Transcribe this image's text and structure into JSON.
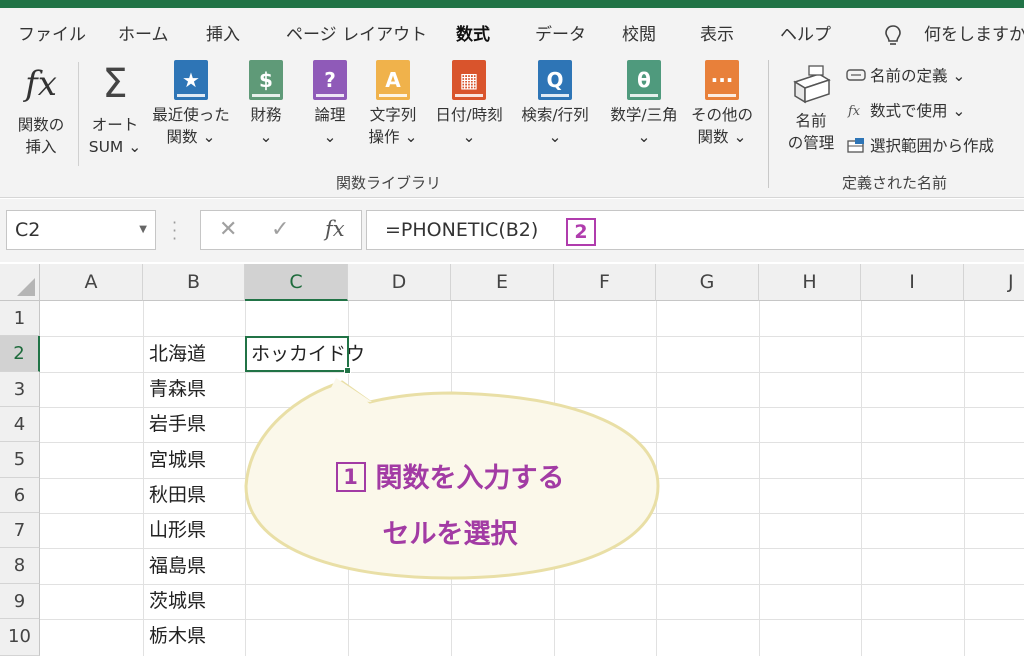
{
  "tabs": [
    "ファイル",
    "ホーム",
    "挿入",
    "ページ レイアウト",
    "数式",
    "データ",
    "校閲",
    "表示",
    "ヘルプ"
  ],
  "active_tab": "数式",
  "tell_me": "何をしますか",
  "ribbon": {
    "insert_function": {
      "line1": "関数の",
      "line2": "挿入"
    },
    "autosum": {
      "line1": "オート",
      "line2": "SUM ⌄"
    },
    "recent": {
      "line1": "最近使った",
      "line2": "関数 ⌄"
    },
    "financial": {
      "line1": "財務",
      "line2": "⌄"
    },
    "logical": {
      "line1": "論理",
      "line2": "⌄"
    },
    "text": {
      "line1": "文字列",
      "line2": "操作 ⌄"
    },
    "datetime": {
      "line1": "日付/時刻",
      "line2": "⌄"
    },
    "lookup": {
      "line1": "検索/行列",
      "line2": "⌄"
    },
    "math": {
      "line1": "数学/三角",
      "line2": "⌄"
    },
    "more": {
      "line1": "その他の",
      "line2": "関数 ⌄"
    },
    "name_manager": {
      "line1": "名前",
      "line2": "の管理"
    },
    "define_name": "名前の定義 ⌄",
    "use_in_formula": "数式で使用 ⌄",
    "create_from_selection": "選択範囲から作成",
    "group_library": "関数ライブラリ",
    "group_names": "定義された名前"
  },
  "icons": {
    "fx_symbol": "fx",
    "sigma": "Σ",
    "recent_sym": "★",
    "financial_sym": "$",
    "logical_sym": "?",
    "text_sym": "A",
    "datetime_sym": "▦",
    "lookup_sym": "Q",
    "math_sym": "θ",
    "more_sym": "···"
  },
  "colors": {
    "recent": "#2e75b6",
    "financial": "#5f9a78",
    "logical": "#8f5ab8",
    "text": "#f0b24b",
    "datetime": "#d9542c",
    "lookup": "#2e75b6",
    "math": "#4f9a7d",
    "more": "#e8803a",
    "excel_green": "#217346",
    "annotation": "#a23ba4"
  },
  "formula_bar": {
    "name_box": "C2",
    "formula": "=PHONETIC(B2)",
    "step_badge": "2"
  },
  "columns": [
    "A",
    "B",
    "C",
    "D",
    "E",
    "F",
    "G",
    "H",
    "I",
    "J"
  ],
  "rows": [
    "1",
    "2",
    "3",
    "4",
    "5",
    "6",
    "7",
    "8",
    "9",
    "10"
  ],
  "cells": {
    "B2": "北海道",
    "C2": "ホッカイドウ",
    "B3": "青森県",
    "B4": "岩手県",
    "B5": "宮城県",
    "B6": "秋田県",
    "B7": "山形県",
    "B8": "福島県",
    "B9": "茨城県",
    "B10": "栃木県"
  },
  "callout": {
    "step_badge": "1",
    "line1": "関数を入力する",
    "line2": "セルを選択"
  }
}
